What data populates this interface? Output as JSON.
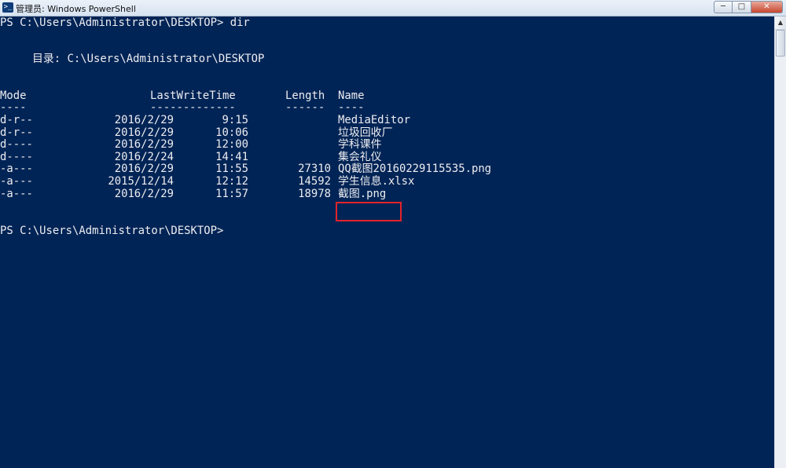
{
  "window": {
    "title": "管理员: Windows PowerShell",
    "app_icon_glyph": ">_",
    "controls": {
      "minimize": "─",
      "maximize": "□",
      "close": "✕"
    }
  },
  "console": {
    "command_prompt": "PS C:\\Users\\Administrator\\DESKTOP> dir",
    "directory_label": "目录: C:\\Users\\Administrator\\DESKTOP",
    "headers": {
      "mode": "Mode",
      "lastwritetime": "LastWriteTime",
      "length": "Length",
      "name": "Name"
    },
    "underlines": {
      "mode": "----",
      "lastwritetime": "-------------",
      "length": "------",
      "name": "----"
    },
    "rows": [
      {
        "mode": "d-r--",
        "date": "2016/2/29",
        "time": "9:15",
        "length": "",
        "name": "MediaEditor"
      },
      {
        "mode": "d-r--",
        "date": "2016/2/29",
        "time": "10:06",
        "length": "",
        "name": "垃圾回收厂"
      },
      {
        "mode": "d----",
        "date": "2016/2/29",
        "time": "12:00",
        "length": "",
        "name": "学科课件"
      },
      {
        "mode": "d----",
        "date": "2016/2/24",
        "time": "14:41",
        "length": "",
        "name": "集会礼仪"
      },
      {
        "mode": "-a---",
        "date": "2016/2/29",
        "time": "11:55",
        "length": "27310",
        "name": "QQ截图20160229115535.png"
      },
      {
        "mode": "-a---",
        "date": "2015/12/14",
        "time": "12:12",
        "length": "14592",
        "name": "学生信息.xlsx"
      },
      {
        "mode": "-a---",
        "date": "2016/2/29",
        "time": "11:57",
        "length": "18978",
        "name": "截图.png"
      }
    ],
    "final_prompt": "PS C:\\Users\\Administrator\\DESKTOP>",
    "highlight_color": "#e3232a",
    "background_color": "#012456",
    "text_color": "#eeedf0"
  },
  "scrollbar": {
    "up_arrow": "▲"
  }
}
